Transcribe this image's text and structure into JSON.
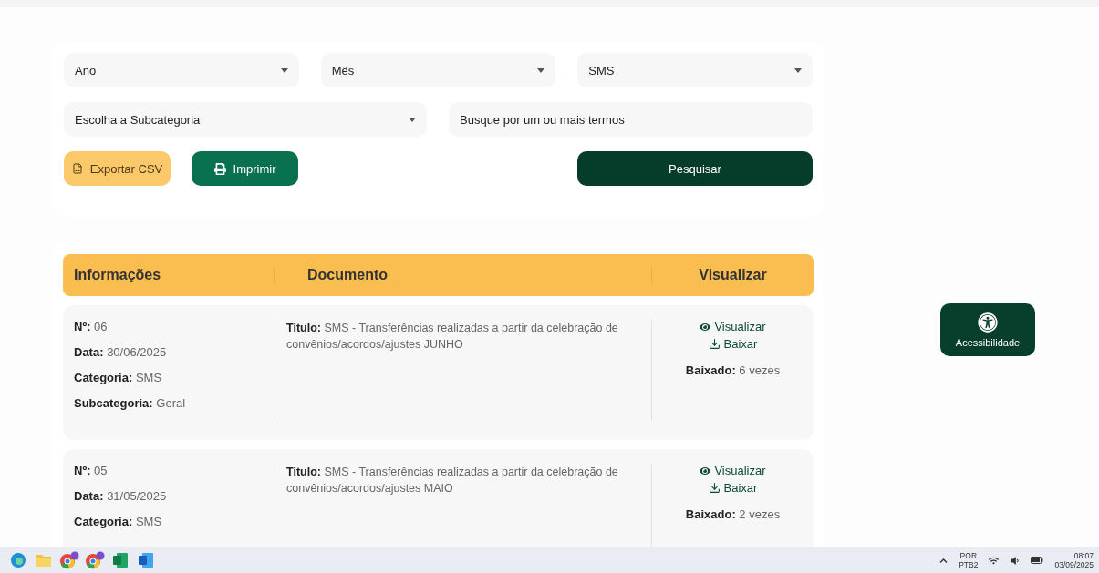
{
  "filters": {
    "selects": [
      {
        "label": "Ano"
      },
      {
        "label": "Mês"
      },
      {
        "label": "SMS"
      }
    ],
    "subcategory": {
      "label": "Escolha a Subcategoria"
    },
    "search": {
      "placeholder": "Busque por um ou mais termos"
    },
    "buttons": [
      {
        "kind": "export",
        "label": "Exportar CSV"
      },
      {
        "kind": "print",
        "label": "Imprimir"
      },
      {
        "kind": "search",
        "label": "Pesquisar"
      }
    ]
  },
  "table": {
    "columns": [
      "Informações",
      "Documento",
      "Visualizar"
    ],
    "rows": [
      {
        "info": [
          "**Nº:** 06",
          "**Data:** 30/06/2025",
          "**Categoria:** SMS",
          "**Subcategoria:** Geral"
        ],
        "title": "**Titulo:** SMS - Transferências realizadas a partir da celebração de convênios/acordos/ajustes JUNHO",
        "view": "Visualizar",
        "download": "Baixar",
        "downloads": "**Baixado:** 6 vezes"
      },
      {
        "info": [
          "**Nº:** 05",
          "**Data:** 31/05/2025",
          "**Categoria:** SMS"
        ],
        "title": "**Titulo:** SMS - Transferências realizadas a partir da celebração de convênios/acordos/ajustes MAIO",
        "view": "Visualizar",
        "download": "Baixar",
        "downloads": "**Baixado:** 2 vezes"
      }
    ]
  },
  "accessibility_button": {
    "label": "Acessibilidade"
  },
  "taskbar": {
    "apps": [
      {
        "kind": "edge"
      },
      {
        "kind": "folder"
      },
      {
        "kind": "chrome"
      },
      {
        "kind": "chrome"
      },
      {
        "kind": "excel"
      },
      {
        "kind": "word"
      }
    ],
    "language": [
      "POR",
      "PTB2"
    ],
    "time": "08:07",
    "date": "03/09/2025"
  }
}
